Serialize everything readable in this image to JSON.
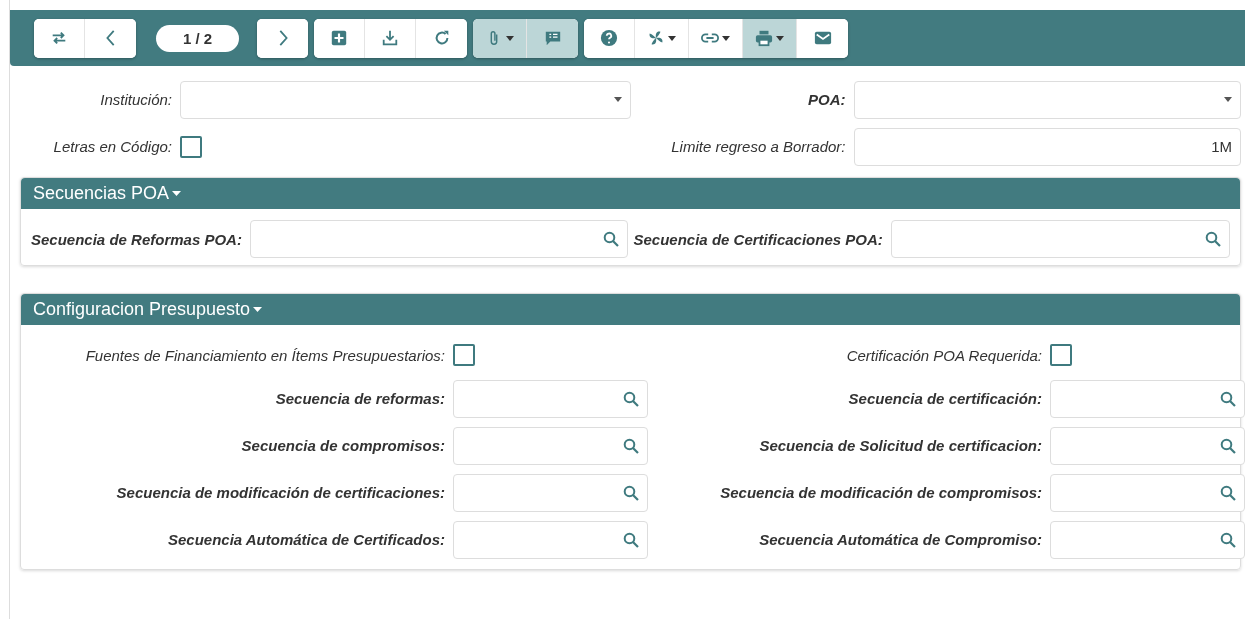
{
  "toolbar": {
    "groups": [
      {
        "kind": "buttons",
        "buttons": [
          {
            "active": false
          },
          {
            "active": false
          }
        ]
      },
      {
        "kind": "pager",
        "label": "1 / 2"
      },
      {
        "kind": "buttons",
        "buttons": [
          {
            "active": false
          }
        ]
      },
      {
        "kind": "buttons",
        "buttons": [
          {
            "active": false
          },
          {
            "active": false
          },
          {
            "active": false
          }
        ]
      },
      {
        "kind": "buttons",
        "buttons": [
          {
            "active": true
          },
          {
            "active": true
          }
        ]
      },
      {
        "kind": "buttons",
        "buttons": [
          {
            "active": false
          },
          {
            "active": false
          },
          {
            "active": false
          },
          {
            "active": true
          },
          {
            "active": false
          }
        ]
      }
    ]
  },
  "header_rows": [
    [
      {
        "label": "Institución:",
        "required": false,
        "kind": "select"
      },
      {
        "label": "POA:",
        "required": true,
        "kind": "select"
      }
    ],
    [
      {
        "label": "Letras en Código:",
        "required": false,
        "kind": "checkbox",
        "checked": false
      },
      {
        "label": "Limite regreso a Borrador:",
        "required": false,
        "kind": "text",
        "value": "1M"
      }
    ]
  ],
  "sections": [
    {
      "title": "Secuencias POA",
      "expanded": true,
      "rows": [
        [
          {
            "label": "Secuencia de Reformas POA:",
            "required": true,
            "kind": "search"
          },
          {
            "label": "Secuencia de Certificaciones POA:",
            "required": true,
            "kind": "search"
          }
        ]
      ]
    },
    {
      "title": "Configuracion Presupuesto",
      "expanded": true,
      "rows": [
        [
          {
            "label": "Fuentes de Financiamiento en Ítems Presupuestarios:",
            "required": false,
            "kind": "checkbox",
            "checked": false
          },
          {
            "label": "Certificación POA Requerida:",
            "required": false,
            "kind": "checkbox",
            "checked": false
          }
        ],
        [
          {
            "label": "Secuencia de reformas:",
            "required": true,
            "kind": "search"
          },
          {
            "label": "Secuencia de certificación:",
            "required": true,
            "kind": "search"
          }
        ],
        [
          {
            "label": "Secuencia de compromisos:",
            "required": true,
            "kind": "search"
          },
          {
            "label": "Secuencia de Solicitud de certificacion:",
            "required": true,
            "kind": "search"
          }
        ],
        [
          {
            "label": "Secuencia de modificación de certificaciones:",
            "required": true,
            "kind": "search"
          },
          {
            "label": "Secuencia de modificación de compromisos:",
            "required": true,
            "kind": "search"
          }
        ],
        [
          {
            "label": "Secuencia Automática de Certificados:",
            "required": true,
            "kind": "search"
          },
          {
            "label": "Secuencia Automática de Compromiso:",
            "required": true,
            "kind": "search"
          }
        ]
      ]
    }
  ]
}
